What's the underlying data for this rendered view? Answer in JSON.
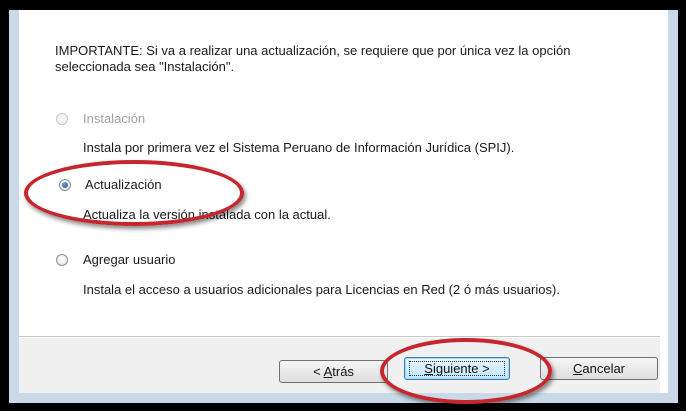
{
  "dialog": {
    "intro": "IMPORTANTE: Si va a realizar una actualización, se requiere que por única vez la opción seleccionada sea \"Instalación\".",
    "options": [
      {
        "label": "Instalación",
        "description": "Instala por primera vez el Sistema Peruano de Información Jurídica (SPIJ).",
        "state": "disabled"
      },
      {
        "label": "Actualización",
        "description": "Actualiza la versión instalada con la actual.",
        "state": "checked"
      },
      {
        "label": "Agregar usuario",
        "description": "Instala el acceso a usuarios adicionales para Licencias en Red (2 ó más usuarios).",
        "state": "unchecked"
      }
    ]
  },
  "buttons": {
    "back": {
      "before": "< ",
      "mnemonic": "A",
      "after": "trás"
    },
    "next": {
      "mnemonic": "S",
      "after": "iguiente >"
    },
    "cancel": {
      "mnemonic": "C",
      "after": "ancelar"
    }
  },
  "colors": {
    "highlight_ellipse": "#c6262e",
    "frame": "#000000",
    "frame_inner": "#c9d9ea"
  }
}
